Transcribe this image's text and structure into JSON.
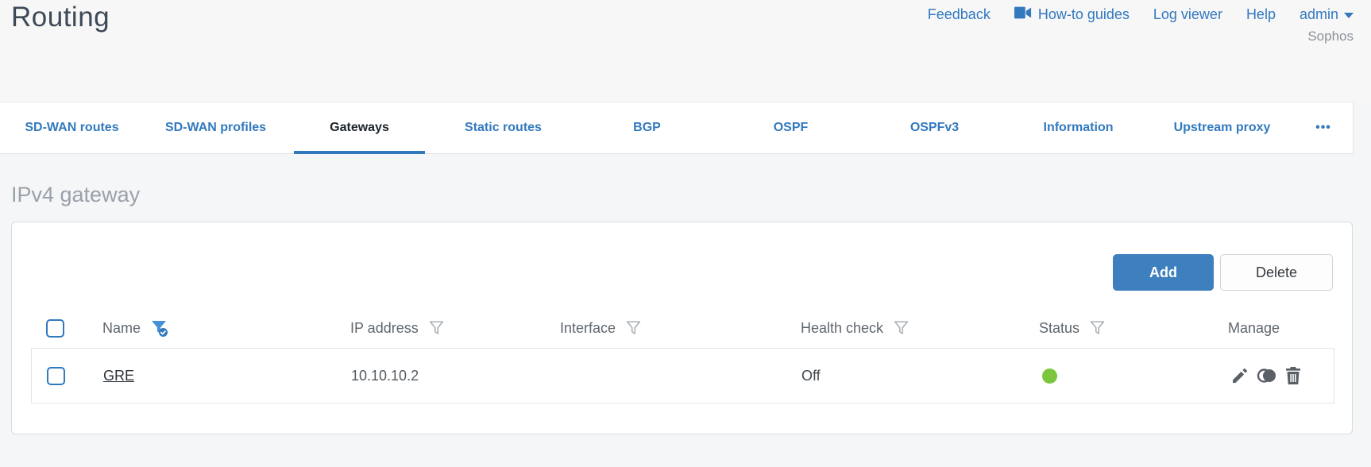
{
  "page": {
    "title": "Routing",
    "brand": "Sophos"
  },
  "topnav": {
    "feedback": "Feedback",
    "howto_guides": "How-to guides",
    "log_viewer": "Log viewer",
    "help": "Help",
    "user": "admin"
  },
  "tabs": [
    {
      "label": "SD-WAN routes",
      "active": false
    },
    {
      "label": "SD-WAN profiles",
      "active": false
    },
    {
      "label": "Gateways",
      "active": true
    },
    {
      "label": "Static routes",
      "active": false
    },
    {
      "label": "BGP",
      "active": false
    },
    {
      "label": "OSPF",
      "active": false
    },
    {
      "label": "OSPFv3",
      "active": false
    },
    {
      "label": "Information",
      "active": false
    },
    {
      "label": "Upstream proxy",
      "active": false
    },
    {
      "label": "•••",
      "active": false
    }
  ],
  "section": {
    "heading": "IPv4 gateway"
  },
  "toolbar": {
    "add": "Add",
    "delete": "Delete"
  },
  "table": {
    "columns": {
      "name": "Name",
      "ip": "IP address",
      "interface": "Interface",
      "health": "Health check",
      "status": "Status",
      "manage": "Manage"
    },
    "filters": {
      "name": "active",
      "ip": "inactive",
      "interface": "inactive",
      "health": "inactive",
      "status": "inactive"
    },
    "rows": [
      {
        "name": "GRE",
        "ip": "10.10.10.2",
        "interface": "",
        "health_check": "Off",
        "status_color": "#7cc63d",
        "actions": [
          "edit",
          "clone",
          "delete"
        ]
      }
    ]
  },
  "colors": {
    "accent": "#3279be",
    "status_green": "#7cc63d"
  }
}
